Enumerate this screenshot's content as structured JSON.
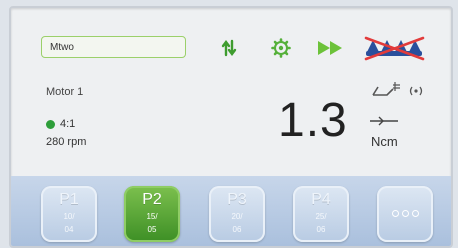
{
  "header": {
    "name_field_value": "Mtwo",
    "icons": [
      "swap-arrows-icon",
      "gear-icon",
      "fast-forward-icon",
      "crossed-out-instrument-icon"
    ]
  },
  "motor": {
    "label": "Motor 1",
    "status_icons": [
      "handpiece-light-icon",
      "sound-wave-icon"
    ]
  },
  "settings": {
    "ratio": "4:1",
    "speed": "280 rpm"
  },
  "torque": {
    "value": "1.3",
    "unit": "Ncm"
  },
  "programs": [
    {
      "name": "P1",
      "line1": "10/",
      "line2": "04",
      "active": false
    },
    {
      "name": "P2",
      "line1": "15/",
      "line2": "05",
      "active": true
    },
    {
      "name": "P3",
      "line1": "20/",
      "line2": "06",
      "active": false
    },
    {
      "name": "P4",
      "line1": "25/",
      "line2": "06",
      "active": false
    }
  ],
  "colors": {
    "accent_green": "#3d8f25",
    "button_blue": "#b8cbe3",
    "alert_red": "#e23b3b",
    "instrument_blue": "#2a4f9c"
  }
}
